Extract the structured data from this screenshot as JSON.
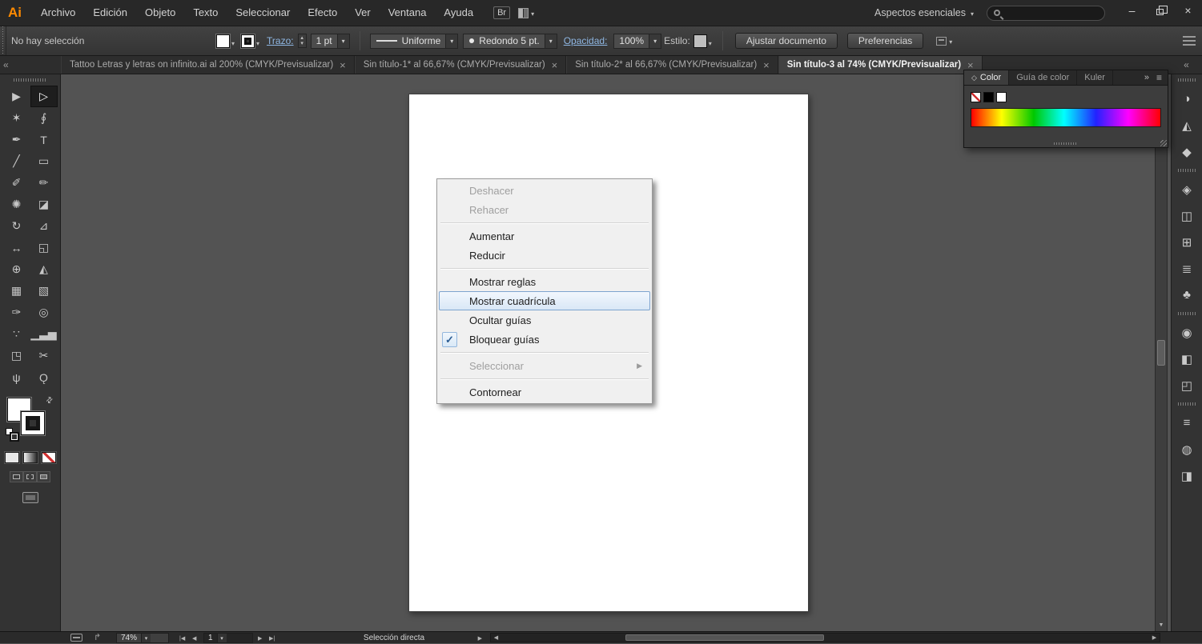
{
  "app": {
    "logo": "Ai",
    "window_controls": {
      "minimize": "–",
      "close": "×"
    }
  },
  "menubar": {
    "items": [
      "Archivo",
      "Edición",
      "Objeto",
      "Texto",
      "Seleccionar",
      "Efecto",
      "Ver",
      "Ventana",
      "Ayuda"
    ],
    "bridge_label": "Br",
    "workspace_label": "Aspectos esenciales"
  },
  "search": {
    "value": ""
  },
  "control_bar": {
    "selection_status": "No hay selección",
    "stroke_label": "Trazo:",
    "stroke_width": "1 pt",
    "profile": "Uniforme",
    "brush": "Redondo 5 pt.",
    "opacity_label": "Opacidad:",
    "opacity_value": "100%",
    "style_label": "Estilo:",
    "fit_document": "Ajustar documento",
    "preferences": "Preferencias"
  },
  "tabs": [
    {
      "label": "Tattoo Letras y letras on infinito.ai al 200% (CMYK/Previsualizar)",
      "active": false
    },
    {
      "label": "Sin título-1* al 66,67% (CMYK/Previsualizar)",
      "active": false
    },
    {
      "label": "Sin título-2* al 66,67% (CMYK/Previsualizar)",
      "active": false
    },
    {
      "label": "Sin título-3 al 74% (CMYK/Previsualizar)",
      "active": true
    }
  ],
  "tools": [
    {
      "name": "selection-tool",
      "glyph": "▶",
      "active": false
    },
    {
      "name": "direct-selection-tool",
      "glyph": "▷",
      "active": true
    },
    {
      "name": "magic-wand-tool",
      "glyph": "✶",
      "active": false
    },
    {
      "name": "lasso-tool",
      "glyph": "∮",
      "active": false
    },
    {
      "name": "pen-tool",
      "glyph": "✒",
      "active": false
    },
    {
      "name": "type-tool",
      "glyph": "T",
      "active": false
    },
    {
      "name": "line-segment-tool",
      "glyph": "╱",
      "active": false
    },
    {
      "name": "rectangle-tool",
      "glyph": "▭",
      "active": false
    },
    {
      "name": "paintbrush-tool",
      "glyph": "✐",
      "active": false
    },
    {
      "name": "pencil-tool",
      "glyph": "✏",
      "active": false
    },
    {
      "name": "blob-brush-tool",
      "glyph": "✺",
      "active": false
    },
    {
      "name": "eraser-tool",
      "glyph": "◪",
      "active": false
    },
    {
      "name": "rotate-tool",
      "glyph": "↻",
      "active": false
    },
    {
      "name": "scale-tool",
      "glyph": "⊿",
      "active": false
    },
    {
      "name": "width-tool",
      "glyph": "↔",
      "active": false
    },
    {
      "name": "free-transform-tool",
      "glyph": "◱",
      "active": false
    },
    {
      "name": "shape-builder-tool",
      "glyph": "⊕",
      "active": false
    },
    {
      "name": "perspective-grid-tool",
      "glyph": "◭",
      "active": false
    },
    {
      "name": "mesh-tool",
      "glyph": "▦",
      "active": false
    },
    {
      "name": "gradient-tool",
      "glyph": "▧",
      "active": false
    },
    {
      "name": "eyedropper-tool",
      "glyph": "✑",
      "active": false
    },
    {
      "name": "blend-tool",
      "glyph": "◎",
      "active": false
    },
    {
      "name": "symbol-sprayer-tool",
      "glyph": "∵",
      "active": false
    },
    {
      "name": "column-graph-tool",
      "glyph": "▁▃▅",
      "active": false
    },
    {
      "name": "artboard-tool",
      "glyph": "◳",
      "active": false
    },
    {
      "name": "slice-tool",
      "glyph": "✂",
      "active": false
    },
    {
      "name": "hand-tool",
      "glyph": "ψ",
      "active": false
    },
    {
      "name": "zoom-tool",
      "glyph": "Ǫ",
      "active": false
    }
  ],
  "dock": {
    "groups": [
      [
        {
          "name": "color-panel-icon",
          "glyph": "◑"
        },
        {
          "name": "color-guide-panel-icon",
          "glyph": "◭"
        },
        {
          "name": "appearance-panel-icon",
          "glyph": "◆"
        }
      ],
      [
        {
          "name": "layers-panel-icon",
          "glyph": "◈"
        },
        {
          "name": "artboards-panel-icon",
          "glyph": "◫"
        },
        {
          "name": "swatches-panel-icon",
          "glyph": "⊞"
        },
        {
          "name": "align-panel-icon",
          "glyph": "≣"
        },
        {
          "name": "pathfinder-panel-icon",
          "glyph": "♣"
        }
      ],
      [
        {
          "name": "gradient-panel-icon",
          "glyph": "◉"
        },
        {
          "name": "transparency-panel-icon",
          "glyph": "◧"
        },
        {
          "name": "symbols-panel-icon",
          "glyph": "◰"
        }
      ],
      [
        {
          "name": "paragraph-panel-icon",
          "glyph": "≡"
        },
        {
          "name": "stroke-panel-icon",
          "glyph": "◍"
        },
        {
          "name": "graphic-styles-panel-icon",
          "glyph": "◨"
        }
      ]
    ]
  },
  "color_panel": {
    "tabs": [
      {
        "label": "Color",
        "active": true
      },
      {
        "label": "Guía de color",
        "active": false
      },
      {
        "label": "Kuler",
        "active": false
      }
    ],
    "swatches": [
      "none",
      "black",
      "white"
    ]
  },
  "context_menu": {
    "items": [
      {
        "label": "Deshacer",
        "state": "disabled"
      },
      {
        "label": "Rehacer",
        "state": "disabled"
      },
      {
        "type": "separator"
      },
      {
        "label": "Aumentar"
      },
      {
        "label": "Reducir"
      },
      {
        "type": "separator"
      },
      {
        "label": "Mostrar reglas"
      },
      {
        "label": "Mostrar cuadrícula",
        "state": "highlighted"
      },
      {
        "label": "Ocultar guías"
      },
      {
        "label": "Bloquear guías",
        "checked": true
      },
      {
        "type": "separator"
      },
      {
        "label": "Seleccionar",
        "state": "disabled",
        "submenu": true
      },
      {
        "type": "separator"
      },
      {
        "label": "Contornear"
      }
    ]
  },
  "status_bar": {
    "zoom": "74%",
    "artboard": "1",
    "tool_label": "Selección directa"
  },
  "theme": {
    "accent_orange": "#FF8A00",
    "highlight_blue_border": "#7EA4CF",
    "highlight_blue_fill": "#DCE9F8",
    "canvas_gray": "#535353",
    "panel_dark": "#333333",
    "context_menu_bg": "#F0F0F0"
  }
}
